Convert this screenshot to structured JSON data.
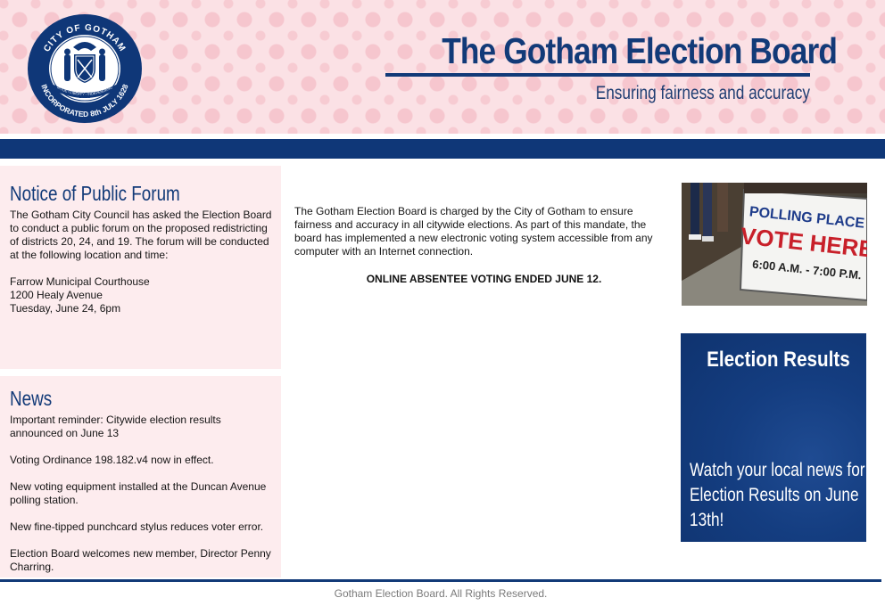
{
  "header": {
    "seal": {
      "top_text": "CITY OF GOTHAM",
      "bottom_text": "INCORPORATED 8th JULY 1628",
      "ribbon": "VIRTUE • LIBERTY • INDEPENDENCE",
      "year": "1628"
    },
    "title": "The Gotham Election Board",
    "tagline": "Ensuring fairness and accuracy"
  },
  "forum": {
    "heading": "Notice of Public Forum",
    "intro": "The Gotham City Council has asked the Election Board to conduct a public forum on the proposed redistricting of districts 20, 24, and 19. The forum will be conducted at the following location and time:",
    "address": [
      "Farrow Municipal Courthouse",
      "1200 Healy Avenue",
      "Tuesday, June 24, 6pm"
    ]
  },
  "news": {
    "heading": "News",
    "items": [
      "Important reminder: Citywide election results announced on June 13",
      "Voting Ordinance 198.182.v4 now in effect.",
      "New voting equipment installed at the Duncan Avenue polling station.",
      "New fine-tipped punchcard stylus reduces voter error.",
      "Election Board welcomes new member, Director Penny Charring."
    ]
  },
  "main": {
    "intro": "The Gotham Election Board is charged by the City of Gotham to ensure fairness and accuracy in all citywide elections. As part of this mandate, the board has implemented a new electronic voting system accessible from any computer with an Internet connection.",
    "notice": "ONLINE ABSENTEE VOTING ENDED JUNE 12."
  },
  "photo": {
    "sign_line1": "POLLING PLACE",
    "sign_line2": "VOTE HERE",
    "sign_line3": "6:00 A.M. - 7:00 P.M."
  },
  "results": {
    "title": "Election Results",
    "body": "Watch your local news for Election Results on June 13th!"
  },
  "footer": {
    "text": "Gotham Election Board. All Rights Reserved."
  },
  "colors": {
    "brand_blue": "#123a78",
    "header_pink": "#fbe1e5",
    "sidebar_pink": "#fdecee",
    "sign_red": "#c8202a"
  }
}
